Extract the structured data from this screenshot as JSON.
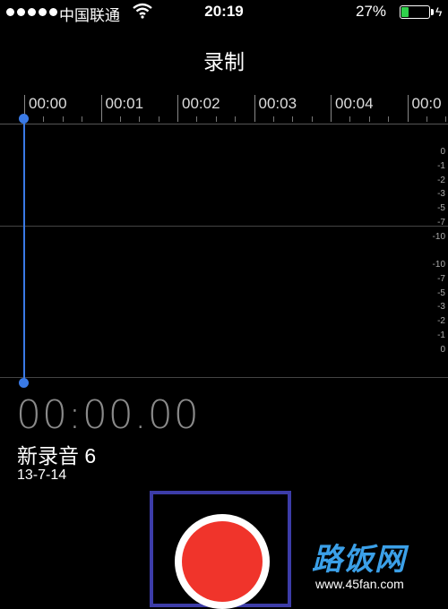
{
  "status_bar": {
    "carrier": "中国联通",
    "time": "20:19",
    "battery_percent": "27%",
    "battery_level": 0.27,
    "signal_icon": "signal-dots-icon",
    "wifi_icon": "wifi-icon",
    "battery_icon": "battery-icon",
    "charging_icon": "charging-bolt-icon"
  },
  "header": {
    "title": "录制"
  },
  "timeline": {
    "labels": [
      "00:00",
      "00:01",
      "00:02",
      "00:03",
      "00:04",
      "00:0"
    ]
  },
  "meter": {
    "top_scale": [
      "0",
      "-1",
      "-2",
      "-3",
      "-5",
      "-7",
      "-10"
    ],
    "bottom_scale": [
      "-10",
      "-7",
      "-5",
      "-3",
      "-2",
      "-1",
      "0"
    ]
  },
  "recording": {
    "elapsed": "00:00.00",
    "name": "新录音 6",
    "date": "13-7-14"
  },
  "controls": {
    "record_icon": "record-icon"
  },
  "watermark": {
    "logo": "路饭网",
    "url": "www.45fan.com"
  },
  "colors": {
    "accent": "#3a7ae6",
    "record": "#f0342b",
    "battery": "#2fd14b",
    "highlight": "#3c3ca8"
  }
}
